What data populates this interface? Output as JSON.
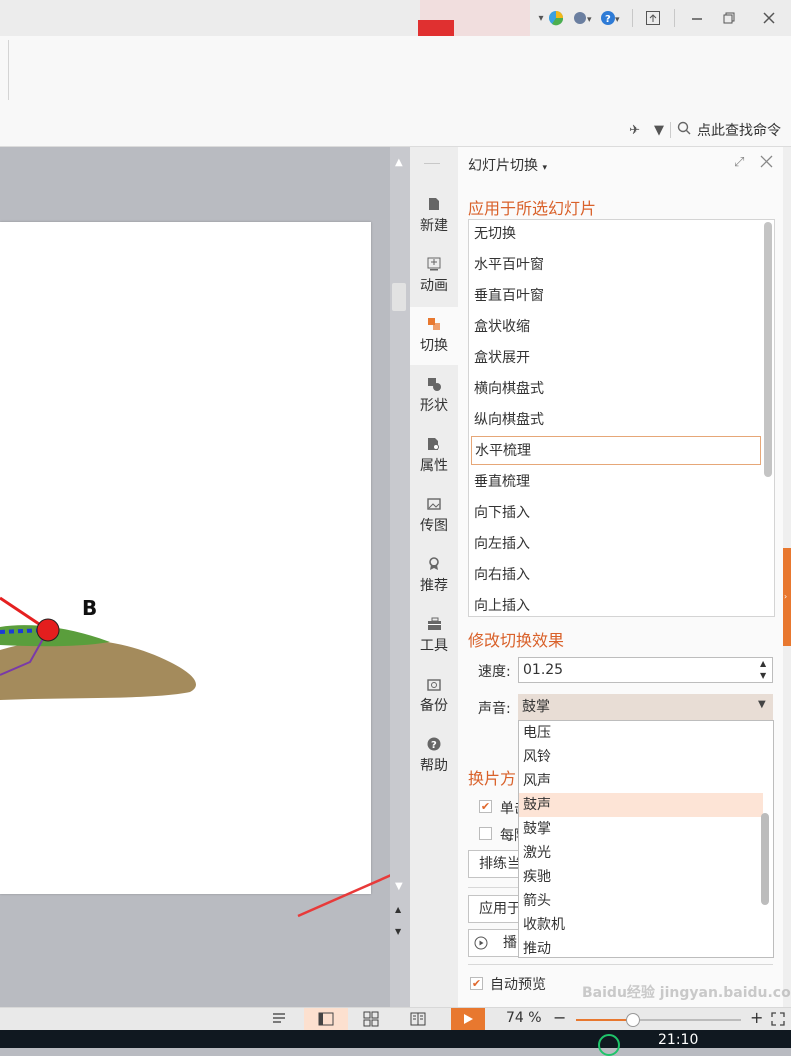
{
  "toolbar": {
    "command_search": "点此查找命令"
  },
  "slide": {
    "point_label": "B"
  },
  "sidebar": {
    "items": [
      {
        "label": "新建",
        "icon": "new-doc-icon"
      },
      {
        "label": "动画",
        "icon": "animation-icon"
      },
      {
        "label": "切换",
        "icon": "transition-icon"
      },
      {
        "label": "形状",
        "icon": "shape-icon"
      },
      {
        "label": "属性",
        "icon": "property-icon"
      },
      {
        "label": "传图",
        "icon": "upload-image-icon"
      },
      {
        "label": "推荐",
        "icon": "recommend-icon"
      },
      {
        "label": "工具",
        "icon": "toolbox-icon"
      },
      {
        "label": "备份",
        "icon": "backup-icon"
      },
      {
        "label": "帮助",
        "icon": "help-icon"
      }
    ]
  },
  "panel": {
    "title": "幻灯片切换",
    "apply_section": "应用于所选幻灯片",
    "transitions": [
      "无切换",
      "水平百叶窗",
      "垂直百叶窗",
      "盒状收缩",
      "盒状展开",
      "横向棋盘式",
      "纵向棋盘式",
      "水平梳理",
      "垂直梳理",
      "向下插入",
      "向左插入",
      "向右插入",
      "向上插入"
    ],
    "selected_transition": "水平梳理",
    "modify_section": "修改切换效果",
    "speed_label": "速度:",
    "speed_value": "01.25",
    "sound_label": "声音:",
    "sound_value": "鼓掌",
    "sound_options": [
      "电压",
      "风铃",
      "风声",
      "鼓声",
      "鼓掌",
      "激光",
      "疾驰",
      "箭头",
      "收款机",
      "推动"
    ],
    "highlighted_sound": "鼓声",
    "switch_section": "换片方",
    "on_click_label": "单击",
    "every_label": "每隔",
    "rehearse_button": "排练当",
    "apply_button": "应用于",
    "play_button": "播",
    "auto_preview_label": "自动预览"
  },
  "statusbar": {
    "zoom": "74 %"
  },
  "taskbar": {
    "time": "21:10"
  },
  "watermark": "Baidu经验 jingyan.baidu.com"
}
